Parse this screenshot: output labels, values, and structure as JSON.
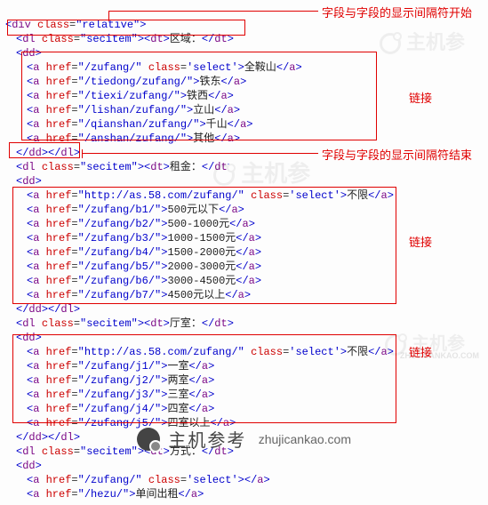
{
  "annotations": {
    "sep_start": "字段与字段的显示间隔符开始",
    "sep_end": "字段与字段的显示间隔符结束",
    "link": "链接"
  },
  "root": {
    "div_attr": "class=\"relative\""
  },
  "section1": {
    "dl_attr": "class=\"secitem\"",
    "dt_label": "区域：",
    "links": [
      {
        "href": "/zufang/",
        "cls": " class='select'",
        "text": "全鞍山"
      },
      {
        "href": "/tiedong/zufang/",
        "cls": "",
        "text": "铁东"
      },
      {
        "href": "/tiexi/zufang/",
        "cls": "",
        "text": "铁西"
      },
      {
        "href": "/lishan/zufang/",
        "cls": "",
        "text": "立山"
      },
      {
        "href": "/qianshan/zufang/",
        "cls": "",
        "text": "千山"
      },
      {
        "href": "/anshan/zufang/",
        "cls": "",
        "text": "其他"
      }
    ],
    "close": "</dd></dl>"
  },
  "section2": {
    "dl_attr": "class=\"secitem\"",
    "dt_label": "租金：",
    "links": [
      {
        "href": "http://as.58.com/zufang/",
        "cls": " class='select'",
        "text": "不限"
      },
      {
        "href": "/zufang/b1/",
        "cls": "",
        "text": "500元以下"
      },
      {
        "href": "/zufang/b2/",
        "cls": "",
        "text": "500-1000元"
      },
      {
        "href": "/zufang/b3/",
        "cls": "",
        "text": "1000-1500元"
      },
      {
        "href": "/zufang/b4/",
        "cls": "",
        "text": "1500-2000元"
      },
      {
        "href": "/zufang/b5/",
        "cls": "",
        "text": "2000-3000元"
      },
      {
        "href": "/zufang/b6/",
        "cls": "",
        "text": "3000-4500元"
      },
      {
        "href": "/zufang/b7/",
        "cls": "",
        "text": "4500元以上"
      }
    ]
  },
  "section3": {
    "dl_attr": "class=\"secitem\"",
    "dt_label": "厅室：",
    "links": [
      {
        "href": "http://as.58.com/zufang/",
        "cls": " class='select'",
        "text": "不限"
      },
      {
        "href": "/zufang/j1/",
        "cls": "",
        "text": "一室"
      },
      {
        "href": "/zufang/j2/",
        "cls": "",
        "text": "两室"
      },
      {
        "href": "/zufang/j3/",
        "cls": "",
        "text": "三室"
      },
      {
        "href": "/zufang/j4/",
        "cls": "",
        "text": "四室"
      },
      {
        "href": "/zufang/j5/",
        "cls": "",
        "text": "四室以上"
      }
    ]
  },
  "section4": {
    "dl_attr": "class=\"secitem\"",
    "dt_label": "方式：",
    "links": [
      {
        "href": "/zufang/",
        "cls": " class='select'",
        "text": ""
      },
      {
        "href": "/hezu/",
        "cls": "",
        "text": "单间出租"
      }
    ]
  },
  "watermark": {
    "text": "主机参"
  },
  "footer": {
    "brand": "主机参考",
    "url": "zhujicankao.com"
  }
}
